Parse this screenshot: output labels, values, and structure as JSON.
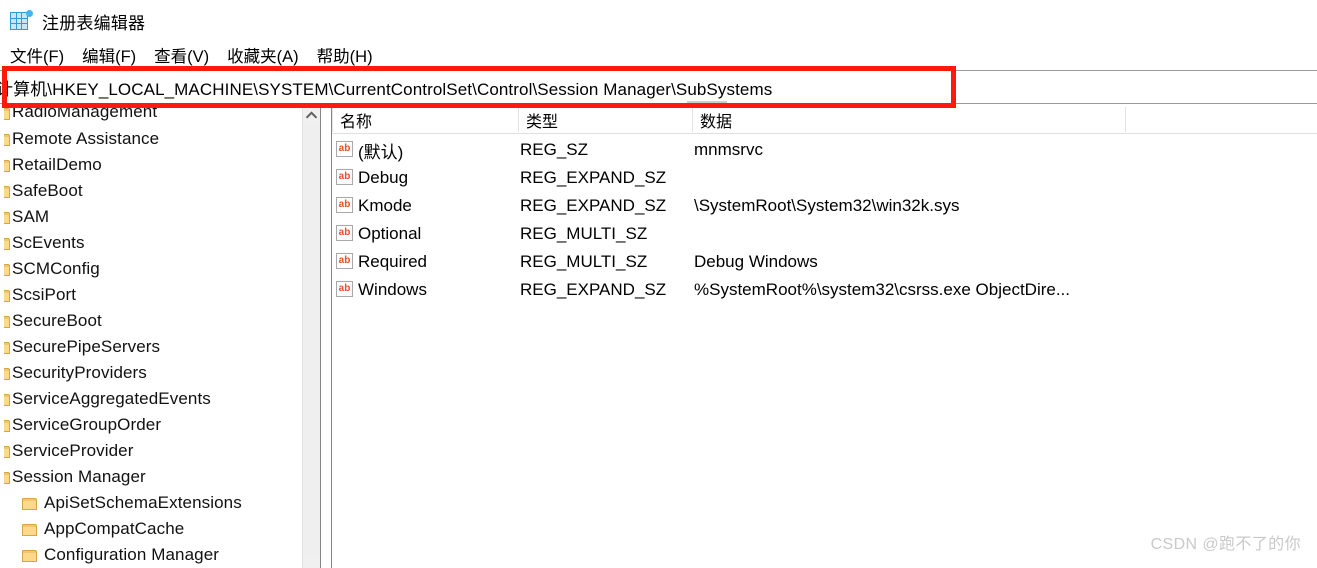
{
  "window": {
    "title": "注册表编辑器",
    "icon": "registry-icon"
  },
  "menu": {
    "items": [
      {
        "label": "文件(F)"
      },
      {
        "label": "编辑(F)"
      },
      {
        "label": "查看(V)"
      },
      {
        "label": "收藏夹(A)"
      },
      {
        "label": "帮助(H)"
      }
    ]
  },
  "address": {
    "value": "计算机\\HKEY_LOCAL_MACHINE\\SYSTEM\\CurrentControlSet\\Control\\Session Manager\\SubSystems",
    "placeholder": ""
  },
  "tree": {
    "items": [
      {
        "label": "RadioManagement",
        "level": 0,
        "clipped": true
      },
      {
        "label": "Remote Assistance",
        "level": 0,
        "clipped": true
      },
      {
        "label": "RetailDemo",
        "level": 0,
        "clipped": true
      },
      {
        "label": "SafeBoot",
        "level": 0,
        "clipped": true
      },
      {
        "label": "SAM",
        "level": 0,
        "clipped": true
      },
      {
        "label": "ScEvents",
        "level": 0,
        "clipped": true
      },
      {
        "label": "SCMConfig",
        "level": 0,
        "clipped": true
      },
      {
        "label": "ScsiPort",
        "level": 0,
        "clipped": true
      },
      {
        "label": "SecureBoot",
        "level": 0,
        "clipped": true
      },
      {
        "label": "SecurePipeServers",
        "level": 0,
        "clipped": true
      },
      {
        "label": "SecurityProviders",
        "level": 0,
        "clipped": true
      },
      {
        "label": "ServiceAggregatedEvents",
        "level": 0,
        "clipped": true
      },
      {
        "label": "ServiceGroupOrder",
        "level": 0,
        "clipped": true
      },
      {
        "label": "ServiceProvider",
        "level": 0,
        "clipped": true
      },
      {
        "label": "Session Manager",
        "level": 0,
        "clipped": true
      },
      {
        "label": "ApiSetSchemaExtensions",
        "level": 1,
        "clipped": false
      },
      {
        "label": "AppCompatCache",
        "level": 1,
        "clipped": false
      },
      {
        "label": "Configuration Manager",
        "level": 1,
        "clipped": false
      }
    ]
  },
  "list": {
    "columns": [
      {
        "label": "名称"
      },
      {
        "label": "类型"
      },
      {
        "label": "数据"
      }
    ],
    "rows": [
      {
        "icon": "string-value-icon",
        "name": "(默认)",
        "type": "REG_SZ",
        "data": "mnmsrvc"
      },
      {
        "icon": "string-value-icon",
        "name": "Debug",
        "type": "REG_EXPAND_SZ",
        "data": ""
      },
      {
        "icon": "string-value-icon",
        "name": "Kmode",
        "type": "REG_EXPAND_SZ",
        "data": "\\SystemRoot\\System32\\win32k.sys"
      },
      {
        "icon": "string-value-icon",
        "name": "Optional",
        "type": "REG_MULTI_SZ",
        "data": ""
      },
      {
        "icon": "string-value-icon",
        "name": "Required",
        "type": "REG_MULTI_SZ",
        "data": "Debug Windows"
      },
      {
        "icon": "string-value-icon",
        "name": "Windows",
        "type": "REG_EXPAND_SZ",
        "data": "%SystemRoot%\\system32\\csrss.exe ObjectDire..."
      }
    ]
  },
  "annotation": {
    "color": "#ff1a0d",
    "target": "address-bar"
  },
  "watermark": {
    "text": "CSDN @跑不了的你"
  },
  "scrollbar": {
    "up_arrow_icon": "chevron-up-icon"
  }
}
